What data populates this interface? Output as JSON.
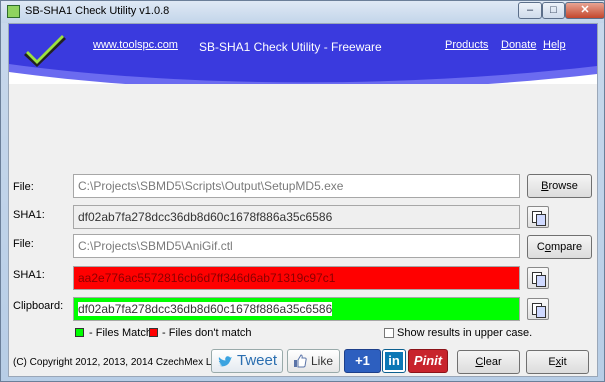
{
  "window": {
    "title": "SB-SHA1 Check Utility  v1.0.8",
    "minimize_glyph": "–",
    "maximize_glyph": "□",
    "close_glyph": "✕"
  },
  "banner": {
    "website": "www.toolspc.com",
    "title": "SB-SHA1 Check Utility - Freeware",
    "products": "Products",
    "donate": "Donate",
    "help": "Help"
  },
  "rows": {
    "file1_label": "File:",
    "file1_path": "C:\\Projects\\SBMD5\\Scripts\\Output\\SetupMD5.exe",
    "browse_pre": "",
    "browse_ul": "B",
    "browse_post": "rowse",
    "sha1_1_label": "SHA1:",
    "sha1_1_value": "df02ab7fa278dcc36db8d60c1678f886a35c6586",
    "file2_label": "File:",
    "file2_path": "C:\\Projects\\SBMD5\\AniGif.ctl",
    "compare_pre": "C",
    "compare_ul": "o",
    "compare_post": "mpare",
    "sha1_2_label": "SHA1:",
    "sha1_2_value": "aa2e776ac5572816cb6d7ff346d6ab71319c97c1",
    "clipboard_label": "Clipboard:",
    "clipboard_value": "df02ab7fa278dcc36db8d60c1678f886a35c6586"
  },
  "legend": {
    "match": "- Files Match",
    "nomatch": "- Files don't match",
    "match_color": "#00ff00",
    "nomatch_color": "#ff0000",
    "uppercase_label": "Show results in upper case.",
    "uppercase_checked": false
  },
  "footer": {
    "copyright": "(C) Copyright 2012, 2013, 2014 CzechMex LLC",
    "tweet": "Tweet",
    "like": "Like",
    "gplus": "+1",
    "linkedin": "in",
    "pinit": "Pinit",
    "clear_ul": "C",
    "clear_post": "lear",
    "exit_pre": "E",
    "exit_ul": "x",
    "exit_post": "it"
  }
}
